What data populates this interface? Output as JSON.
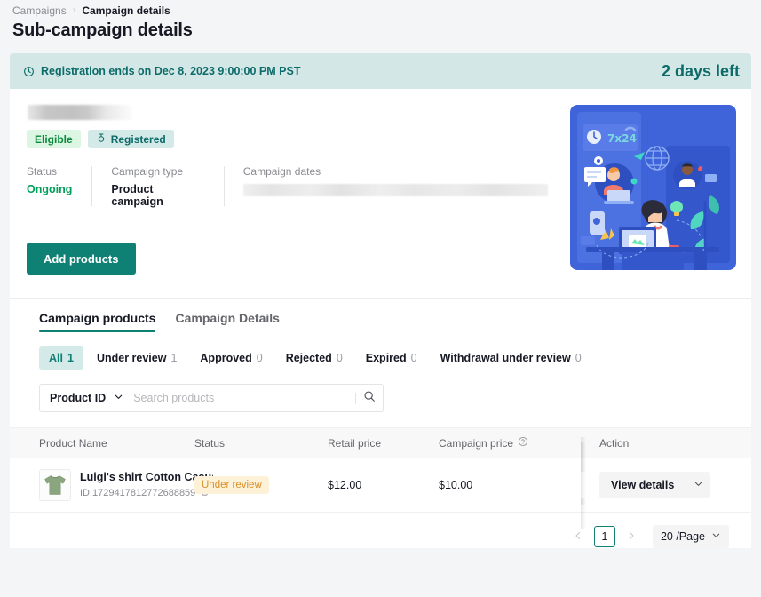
{
  "breadcrumb": {
    "parent": "Campaigns",
    "separator": "›",
    "current": "Campaign details"
  },
  "page_title": "Sub-campaign details",
  "banner": {
    "icon": "clock-icon",
    "text": "Registration ends on Dec 8, 2023 9:00:00 PM PST",
    "days_left": "2 days left",
    "bg_color": "#d3e8e6",
    "text_color": "#0c6b69"
  },
  "summary": {
    "title_redacted": true,
    "badges": [
      {
        "label": "Eligible",
        "icon": null,
        "bg": "#ddf5e3",
        "color": "#0a8a3c"
      },
      {
        "label": "Registered",
        "icon": "medal-icon",
        "bg": "#d3eae8",
        "color": "#0c6b69"
      }
    ],
    "meta": [
      {
        "label": "Status",
        "value": "Ongoing",
        "color": "#00a05a"
      },
      {
        "label": "Campaign type",
        "value": "Product campaign",
        "color": "#161823"
      },
      {
        "label": "Campaign dates",
        "value": "",
        "redacted": true
      }
    ],
    "add_products_label": "Add products",
    "illustration": {
      "alt": "remote-team-illustration",
      "caption": "7x24",
      "bg": "#3f63d8"
    }
  },
  "tabs": [
    {
      "label": "Campaign products",
      "active": true
    },
    {
      "label": "Campaign Details",
      "active": false
    }
  ],
  "filters": [
    {
      "label": "All",
      "count": "1",
      "active": true
    },
    {
      "label": "Under review",
      "count": "1",
      "active": false
    },
    {
      "label": "Approved",
      "count": "0",
      "active": false
    },
    {
      "label": "Rejected",
      "count": "0",
      "active": false
    },
    {
      "label": "Expired",
      "count": "0",
      "active": false
    },
    {
      "label": "Withdrawal under review",
      "count": "0",
      "active": false
    }
  ],
  "search": {
    "select_value": "Product ID",
    "placeholder": "Search products",
    "search_icon": "search-icon",
    "chevron_icon": "chevron-down-icon"
  },
  "table": {
    "columns": [
      "Product Name",
      "Status",
      "Retail price",
      "Campaign price",
      "Action"
    ],
    "campaign_price_help_icon": "question-circle-icon",
    "rows": [
      {
        "thumb": "tshirt-thumbnail",
        "name": "Luigi's shirt Cotton Casua...",
        "id_label": "ID:1729417812772688859",
        "copy_icon": "copy-icon",
        "status": "Under review",
        "status_bg": "#fdf1d8",
        "status_color": "#d8902a",
        "retail_price": "$12.00",
        "campaign_price": "$10.00",
        "action_label": "View details",
        "action_caret_icon": "chevron-down-icon"
      }
    ]
  },
  "pagination": {
    "prev_icon": "chevron-left-icon",
    "next_icon": "chevron-right-icon",
    "current_page": "1",
    "page_size": "20 /Page",
    "page_size_caret": "chevron-down-icon"
  }
}
